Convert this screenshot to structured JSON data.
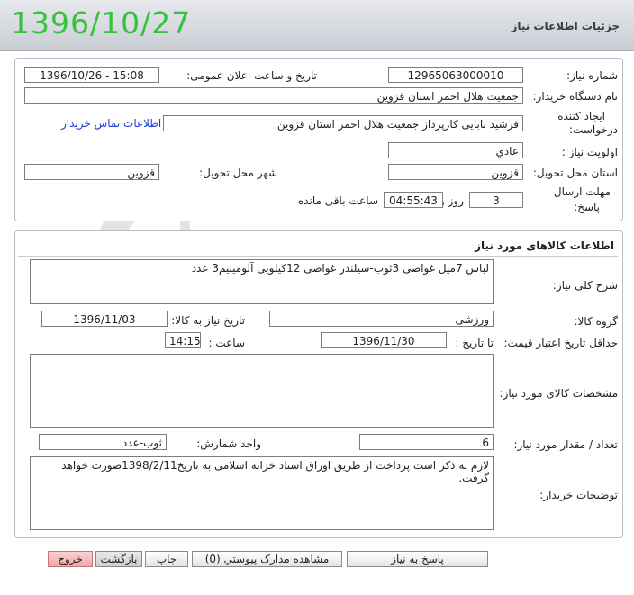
{
  "header": {
    "title": "جزئیات اطلاعات نیاز",
    "date": "1396/10/27"
  },
  "need_info": {
    "need_number_label": "شماره نیاز:",
    "need_number": "12965063000010",
    "announce_label": "تاریخ و ساعت اعلان عمومی:",
    "announce_value": "1396/10/26 - 15:08",
    "buyer_org_label": "نام دستگاه خریدار:",
    "buyer_org": "جمعیت هلال احمر استان قزوین",
    "creator_label_line1": "ایجاد کننده",
    "creator_label_line2": "درخواست:",
    "creator": "فرشید  بابایی کارپرداز جمعیت هلال احمر استان قزوین",
    "contact_link": "اطلاعات تماس خریدار",
    "priority_label": "اولویت نیاز :",
    "priority": "عادي",
    "province_label": "استان محل تحویل:",
    "province": "قزوین",
    "city_label": "شهر محل تحویل:",
    "city": "قزوین",
    "deadline_label_line1": "مهلت ارسال",
    "deadline_label_line2": "پاسخ:",
    "days": "3",
    "days_label": "روز و",
    "time_left": "04:55:43",
    "time_left_label": "ساعت باقی مانده"
  },
  "goods": {
    "section_title": "اطلاعات کالاهای مورد نیاز",
    "general_desc_label": "شرح کلی نیاز:",
    "general_desc": "لباس 7میل غواصی 3ثوب-سیلندر غواصی 12کیلویی آلومینیم3 عدد",
    "group_label": "گروه کالا:",
    "group": "ورزشی",
    "need_date_label": "تاریخ نیاز به کالا:",
    "need_date": "1396/11/03",
    "validity_label": "حداقل تاریخ اعتبار قیمت:",
    "until_date_label": "تا تاریخ :",
    "until_date": "1396/11/30",
    "time_label": "ساعت :",
    "time": "14:15",
    "specs_label": "مشخصات کالای مورد نیاز:",
    "specs": "",
    "qty_label": "تعداد / مقدار مورد نیاز:",
    "qty": "6",
    "unit_label": "واحد شمارش:",
    "unit": "ثوب-عدد",
    "buyer_notes_label": "توضیحات خریدار:",
    "buyer_notes": "لازم به ذکر است پرداخت از طریق اوراق اسناد خزانه اسلامی به تاریخ1398/2/11صورت خواهد گرفت."
  },
  "buttons": {
    "reply": "پاسخ به نیاز",
    "attachments": "مشاهده مدارک پیوستي (0)",
    "print": "چاپ",
    "back": "بازگشت",
    "exit": "خروج"
  },
  "watermark": {
    "main": "هزاره",
    "sub": "ارتباط"
  },
  "colors": {
    "header_date": "#37c23e",
    "link": "#1a3fd6",
    "exit_button": "#f2a7a7"
  }
}
